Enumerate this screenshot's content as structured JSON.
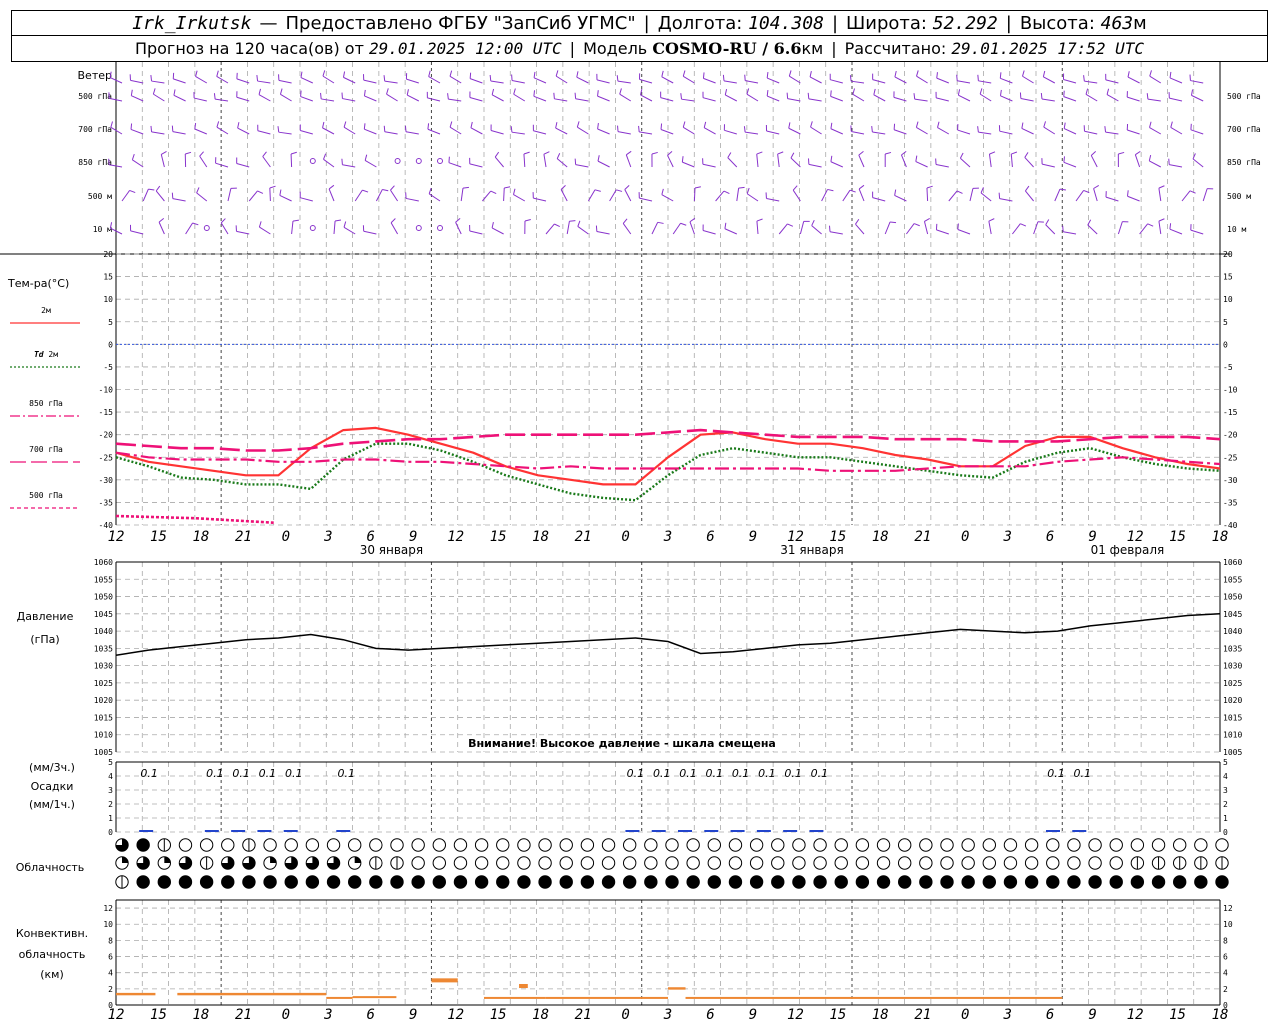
{
  "header": {
    "station": "Irk_Irkutsk",
    "dash": "—",
    "provider": "Предоставлено ФГБУ \"ЗапСиб УГМС\"",
    "lon_label": "Долгота:",
    "lon_value": "104.308",
    "lat_label": "Широта:",
    "lat_value": "52.292",
    "alt_label": "Высота:",
    "alt_value": "463",
    "alt_unit": "м",
    "forecast_label": "Прогноз на 120 часа(ов) от",
    "forecast_start": "29.01.2025 12:00 UTC",
    "model_label": "Модель",
    "model_value": "COSMO-RU / 6.6",
    "model_unit": "км",
    "calc_label": "Рассчитано:",
    "calc_value": "29.01.2025 17:52 UTC"
  },
  "wind_panel": {
    "title": "Ветер",
    "levels": [
      "500 гПа",
      "700 гПа",
      "850 гПа",
      "500 м",
      "10  м"
    ]
  },
  "temperature_panel": {
    "title": "Тем-ра(°C)",
    "legend": [
      {
        "label": "2м",
        "color": "#ff3333",
        "dash": "solid"
      },
      {
        "label_italic": "Td",
        "label": "2м",
        "color": "#1a7a1a",
        "dash": "dotted"
      },
      {
        "label": "850 гПа",
        "color": "#ee1177",
        "dash": "dashdot"
      },
      {
        "label": "700 гПа",
        "color": "#ee1177",
        "dash": "long"
      },
      {
        "label": "500 гПа",
        "color": "#ee1177",
        "dash": "short"
      }
    ],
    "yticks": [
      20,
      15,
      10,
      5,
      0,
      -5,
      -10,
      -15,
      -20,
      -25,
      -30,
      -35,
      -40
    ]
  },
  "pressure_panel": {
    "title": "Давление",
    "unit": "(гПа)",
    "warning": "Внимание! Высокое давление - шкала смещена",
    "yticks": [
      1060,
      1055,
      1050,
      1045,
      1040,
      1035,
      1030,
      1025,
      1020,
      1015,
      1010,
      1005
    ]
  },
  "precip_panel": {
    "label_1": "(мм/3ч.)",
    "label_2": "Осадки",
    "label_3": "(мм/1ч.)",
    "yticks": [
      5,
      4,
      3,
      2,
      1,
      0
    ]
  },
  "cloud_panel": {
    "title": "Облачность"
  },
  "convective_panel": {
    "label_1": "Конвективн.",
    "label_2": "облачность",
    "label_3": "(км)",
    "yticks": [
      12,
      10,
      8,
      6,
      4,
      2,
      0
    ]
  },
  "x_axis": {
    "tick_labels": [
      "12",
      "15",
      "18",
      "21",
      "0",
      "3",
      "6",
      "9",
      "12",
      "15",
      "18",
      "21",
      "0",
      "3",
      "6",
      "9",
      "12",
      "15",
      "18",
      "21",
      "0",
      "3",
      "6",
      "9",
      "12",
      "15",
      "18"
    ],
    "date_labels": [
      "30 января",
      "31 января",
      "01 февраля"
    ]
  },
  "colors": {
    "wind": "#8833cc",
    "pressure": "#000000",
    "precip": "#2244cc",
    "convective": "#ee8833",
    "grid": "#aaaaaa",
    "zero_line": "#3355dd"
  },
  "chart_data": {
    "type": "line",
    "x_hours_from_start": [
      0,
      3,
      6,
      9,
      12,
      15,
      18,
      21,
      24,
      27,
      30,
      33,
      36,
      39,
      42,
      45,
      48,
      51,
      54,
      57,
      60,
      63,
      66,
      69,
      72,
      75,
      78,
      81,
      84,
      87,
      90,
      93,
      96,
      99,
      102,
      105,
      108,
      111,
      114,
      117,
      120,
      123,
      126
    ],
    "series": [
      {
        "name": "2м",
        "values": [
          -24,
          -26,
          -27,
          -28,
          -29,
          -29,
          -23,
          -19,
          -18.5,
          -20,
          -22,
          -24,
          -27,
          -29,
          -30,
          -31,
          -31,
          -25,
          -20,
          -19.5,
          -21,
          -22,
          -22,
          -23,
          -24.5,
          -25.5,
          -27,
          -27,
          -22.5,
          -20.5,
          -20.5,
          -23,
          -25,
          -26.5,
          -27.5
        ]
      },
      {
        "name": "Td 2м",
        "values": [
          -25,
          -27,
          -29.5,
          -30,
          -31,
          -31,
          -32,
          -25.5,
          -22,
          -22,
          -23.5,
          -26,
          -29,
          -31,
          -33,
          -34,
          -34.5,
          -29,
          -24.5,
          -23,
          -24,
          -25,
          -25,
          -26,
          -27,
          -28,
          -29,
          -29.5,
          -26,
          -24,
          -23,
          -25,
          -26.5,
          -27.5,
          -28
        ]
      },
      {
        "name": "850 гПа",
        "values": [
          -24,
          -25,
          -25.5,
          -25.5,
          -25.5,
          -26,
          -26,
          -25.5,
          -25.5,
          -26,
          -26,
          -26.5,
          -27,
          -27.5,
          -27,
          -27.5,
          -27.5,
          -27.5,
          -27.5,
          -27.5,
          -27.5,
          -27.5,
          -28,
          -28,
          -28,
          -27.5,
          -27,
          -27,
          -27,
          -26,
          -25.5,
          -25,
          -25.5,
          -26,
          -26.5
        ]
      },
      {
        "name": "700 гПа",
        "values": [
          -22,
          -22.5,
          -23,
          -23,
          -23.5,
          -23.5,
          -23,
          -22,
          -21.5,
          -21,
          -21,
          -20.5,
          -20,
          -20,
          -20,
          -20,
          -20,
          -19.5,
          -19,
          -19.5,
          -20,
          -20.5,
          -20.5,
          -20.5,
          -21,
          -21,
          -21,
          -21.5,
          -21.5,
          -21.5,
          -21,
          -20.5,
          -20.5,
          -20.5,
          -21
        ]
      },
      {
        "name": "500 гПа",
        "values": [
          -38,
          -38.5,
          -39.5
        ]
      },
      {
        "name": "Давление",
        "values": [
          1033,
          1034.5,
          1035.5,
          1036.5,
          1037.5,
          1038,
          1039,
          1037.5,
          1035,
          1034.5,
          1035,
          1035.5,
          1036,
          1036.5,
          1037,
          1037.5,
          1038,
          1037,
          1033.5,
          1034,
          1035,
          1036,
          1036.5,
          1037.5,
          1038.5,
          1039.5,
          1040.5,
          1040,
          1039.5,
          1040,
          1041.5,
          1042.5,
          1043.5,
          1044.5,
          1045
        ]
      }
    ],
    "precip_label_value": "0.1",
    "precip_label_hours": [
      1.5,
      9,
      12,
      15,
      18,
      24,
      57,
      60,
      63,
      66,
      69,
      72,
      75,
      78,
      105,
      108
    ],
    "temp_ylim": [
      -40,
      20
    ],
    "pressure_ylim": [
      1005,
      1060
    ],
    "precip_ylim": [
      0,
      5
    ],
    "convective_ylim": [
      0,
      13
    ],
    "convective_segments": [
      {
        "h0": 0,
        "h1": 4.5,
        "base": 1.2,
        "top": 1.5
      },
      {
        "h0": 7,
        "h1": 15,
        "base": 1.2,
        "top": 1.5
      },
      {
        "h0": 15,
        "h1": 24,
        "base": 1.2,
        "top": 1.5
      },
      {
        "h0": 24,
        "h1": 27,
        "base": 0.8,
        "top": 1.0
      },
      {
        "h0": 27,
        "h1": 32,
        "base": 0.9,
        "top": 1.1
      },
      {
        "h0": 36,
        "h1": 39,
        "base": 2.8,
        "top": 3.3
      },
      {
        "h0": 42,
        "h1": 49,
        "base": 0.8,
        "top": 1.0
      },
      {
        "h0": 46,
        "h1": 47,
        "base": 2.1,
        "top": 2.6
      },
      {
        "h0": 49,
        "h1": 63,
        "base": 0.8,
        "top": 1.0
      },
      {
        "h0": 63,
        "h1": 65,
        "base": 1.9,
        "top": 2.2
      },
      {
        "h0": 65,
        "h1": 108,
        "base": 0.8,
        "top": 1.0
      }
    ],
    "cloud_rows": [
      [
        "3",
        "4",
        "1",
        "0",
        "0",
        "0",
        "1",
        "0",
        "0",
        "0",
        "0",
        "0",
        "0",
        "0",
        "0",
        "0",
        "0",
        "0",
        "0",
        "0",
        "0",
        "0",
        "0",
        "0",
        "0",
        "0",
        "0",
        "0",
        "0",
        "0",
        "0",
        "0",
        "0",
        "0",
        "0",
        "0",
        "0",
        "0",
        "0",
        "0",
        "0",
        "0",
        "0",
        "0",
        "0",
        "0",
        "0",
        "0",
        "0",
        "0",
        "0",
        "0",
        "0",
        "0",
        "0",
        "0",
        "0",
        "0",
        "0",
        "0",
        "0",
        "0",
        "0",
        "0",
        "0",
        "0",
        "0",
        "0",
        "0",
        "0",
        "0",
        "0",
        "0",
        "0",
        "0",
        "0",
        "0",
        "0",
        "0",
        "0",
        "0",
        "0",
        "0",
        "0",
        "0",
        "0",
        "0",
        "0",
        "0",
        "0",
        "0",
        "0",
        "0",
        "0",
        "0",
        "0",
        "0",
        "0",
        "0",
        "0",
        "0",
        "0",
        "0",
        "0",
        "0",
        "0",
        "0",
        "0",
        "0",
        "0",
        "0",
        "0",
        "0",
        "0",
        "0",
        "0",
        "0",
        "0",
        "0",
        "0",
        "0"
      ],
      [
        "2",
        "3",
        "2",
        "3",
        "1",
        "3",
        "3",
        "2",
        "3",
        "3",
        "3",
        "2",
        "1",
        "1",
        "0",
        "0",
        "0",
        "0",
        "0",
        "0",
        "0",
        "0",
        "0",
        "0",
        "0",
        "0",
        "0",
        "0",
        "0",
        "0",
        "0",
        "0",
        "0",
        "0",
        "0",
        "0",
        "0",
        "0",
        "0",
        "0",
        "0",
        "0",
        "0",
        "0",
        "0",
        "0",
        "0",
        "0",
        "1",
        "1",
        "1",
        "1",
        "1",
        "1",
        "1",
        "3",
        "3",
        "3",
        "4",
        "4",
        "4",
        "4",
        "4",
        "4",
        "3",
        "3",
        "3",
        "3",
        "3",
        "3",
        "3",
        "3",
        "3",
        "3",
        "3",
        "2",
        "2",
        "2",
        "1",
        "1",
        "1",
        "1",
        "1",
        "1",
        "1",
        "1",
        "1",
        "1",
        "1",
        "1",
        "1",
        "1",
        "1",
        "1",
        "1",
        "1",
        "1",
        "1",
        "1",
        "1",
        "1",
        "0",
        "0",
        "0",
        "0",
        "0",
        "0",
        "0",
        "0",
        "0",
        "0",
        "0",
        "0",
        "0",
        "0",
        "0",
        "0",
        "0",
        "0",
        "0",
        "0"
      ],
      [
        "1",
        "4",
        "4",
        "4",
        "4",
        "4",
        "4",
        "4",
        "4",
        "4",
        "4",
        "4",
        "4",
        "4",
        "4",
        "4",
        "4",
        "4",
        "4",
        "4",
        "4",
        "4",
        "4",
        "4",
        "4",
        "4",
        "4",
        "4",
        "4",
        "4",
        "4",
        "4",
        "4",
        "4",
        "4",
        "4",
        "4",
        "4",
        "4",
        "4",
        "4",
        "4",
        "4",
        "4",
        "4",
        "4",
        "4",
        "4",
        "4",
        "4",
        "4",
        "4",
        "4",
        "4",
        "4",
        "4",
        "4",
        "4",
        "4",
        "4",
        "4",
        "4",
        "4",
        "4",
        "4",
        "4",
        "4",
        "4",
        "4",
        "4",
        "4",
        "4",
        "4",
        "4",
        "4",
        "4",
        "4",
        "4",
        "4",
        "4",
        "4",
        "4",
        "4",
        "4",
        "4",
        "4",
        "4",
        "4",
        "4",
        "4",
        "4",
        "4",
        "4",
        "4",
        "4",
        "4",
        "4",
        "4",
        "4",
        "4",
        "4",
        "4",
        "4",
        "4",
        "4",
        "4",
        "4",
        "4",
        "4",
        "4",
        "4",
        "4",
        "4",
        "4",
        "4",
        "4",
        "4",
        "4",
        "4",
        "4",
        "4"
      ]
    ]
  }
}
